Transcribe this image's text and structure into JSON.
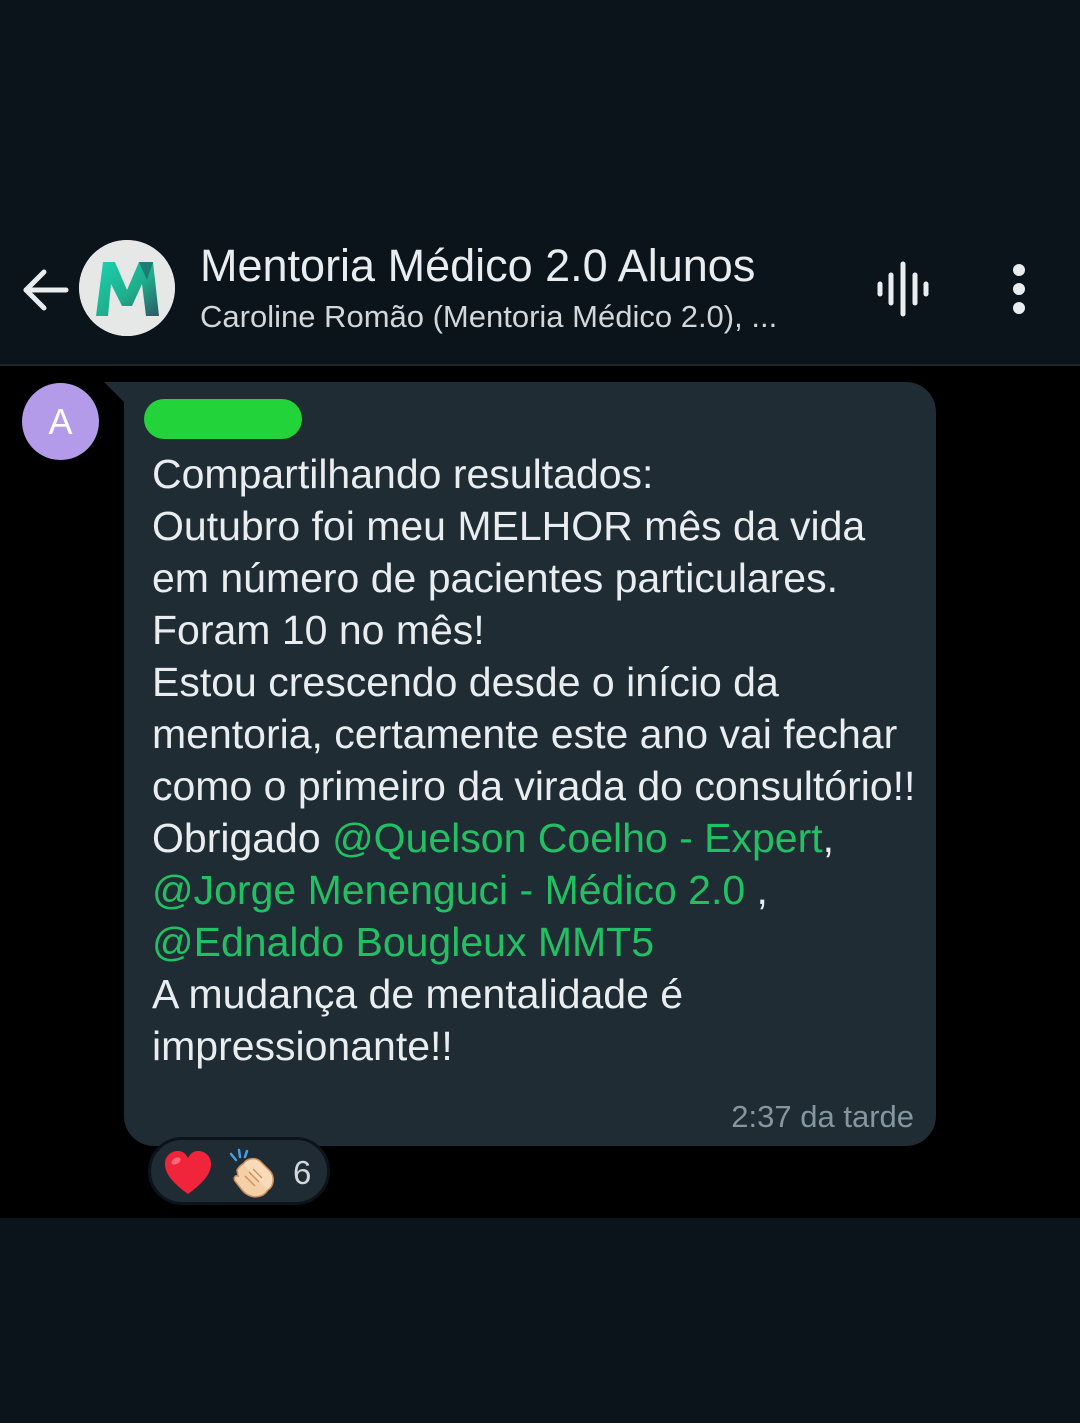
{
  "header": {
    "title": "Mentoria Médico 2.0 Alunos",
    "subtitle": "Caroline Romão (Mentoria Médico 2.0), ...",
    "avatar_letter": "M",
    "back_icon": "arrow-left-icon",
    "voice_icon": "voice-call-waveform-icon",
    "menu_icon": "more-vertical-icon"
  },
  "message": {
    "sender_avatar_letter": "A",
    "sender_name": "",
    "segments": [
      {
        "text": "Compartilhando resultados:\nOutubro foi meu MELHOR mês da vida em número de pacientes particulares. Foram 10 no mês!\nEstou crescendo desde o início da mentoria, certamente este ano vai fechar como o primeiro da virada do consultório!!\nObrigado ",
        "mention": false
      },
      {
        "text": "@Quelson Coelho - Expert",
        "mention": true
      },
      {
        "text": ",\n",
        "mention": false
      },
      {
        "text": "@Jorge Menenguci - Médico 2.0",
        "mention": true
      },
      {
        "text": " ,\n",
        "mention": false
      },
      {
        "text": "@Ednaldo Bougleux MMT5",
        "mention": true
      },
      {
        "text": "\nA mudança de mentalidade é impressionante!!",
        "mention": false
      }
    ],
    "time": "2:37 da tarde"
  },
  "reactions": {
    "emojis": [
      "heart-emoji",
      "clapping-hands-emoji"
    ],
    "count": "6"
  },
  "colors": {
    "background": "#0b141a",
    "chat_background": "#000000",
    "bubble": "#1f2c34",
    "mention": "#21c063",
    "redaction": "#22d43a",
    "avatar": "#b39bea",
    "timestamp": "#8696a0"
  }
}
